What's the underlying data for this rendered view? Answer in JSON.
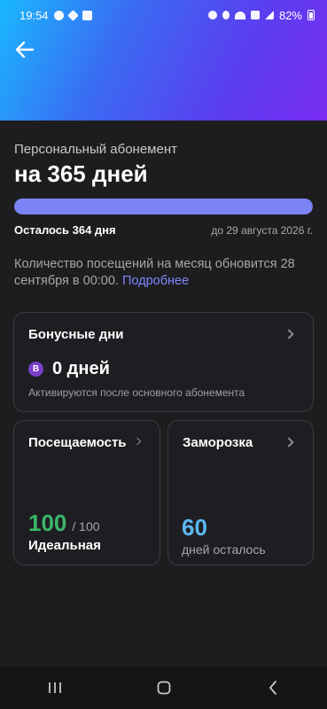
{
  "status_bar": {
    "time": "19:54",
    "battery_text": "82%"
  },
  "header": {
    "back_icon": "back-arrow-icon"
  },
  "subscription": {
    "subtitle": "Персональный абонемент",
    "title": "на 365 дней",
    "progress_fraction": 1.0,
    "remaining": "Осталось 364 дня",
    "until": "до 29 августа 2026 г.",
    "info_text": "Количество посещений на месяц обновится 28 сентября в 00:00.",
    "info_link": "Подробнее"
  },
  "bonus_card": {
    "title": "Бонусные дни",
    "badge": "B",
    "value": "0 дней",
    "note": "Активируются после основного абонемента"
  },
  "visits_card": {
    "title": "Посещаемость",
    "value": "100",
    "max": "/ 100",
    "label": "Идеальная"
  },
  "freeze_card": {
    "title": "Заморозка",
    "value": "60",
    "label": "дней осталось"
  },
  "colors": {
    "accent": "#7c83f4",
    "link": "#7e86ff",
    "visits": "#3ab76a",
    "freeze": "#5ab8f0",
    "badge": "#7a3ec9"
  },
  "nav": {
    "recent_icon": "recent-apps-icon",
    "home_icon": "home-icon",
    "back_icon": "system-back-icon"
  }
}
